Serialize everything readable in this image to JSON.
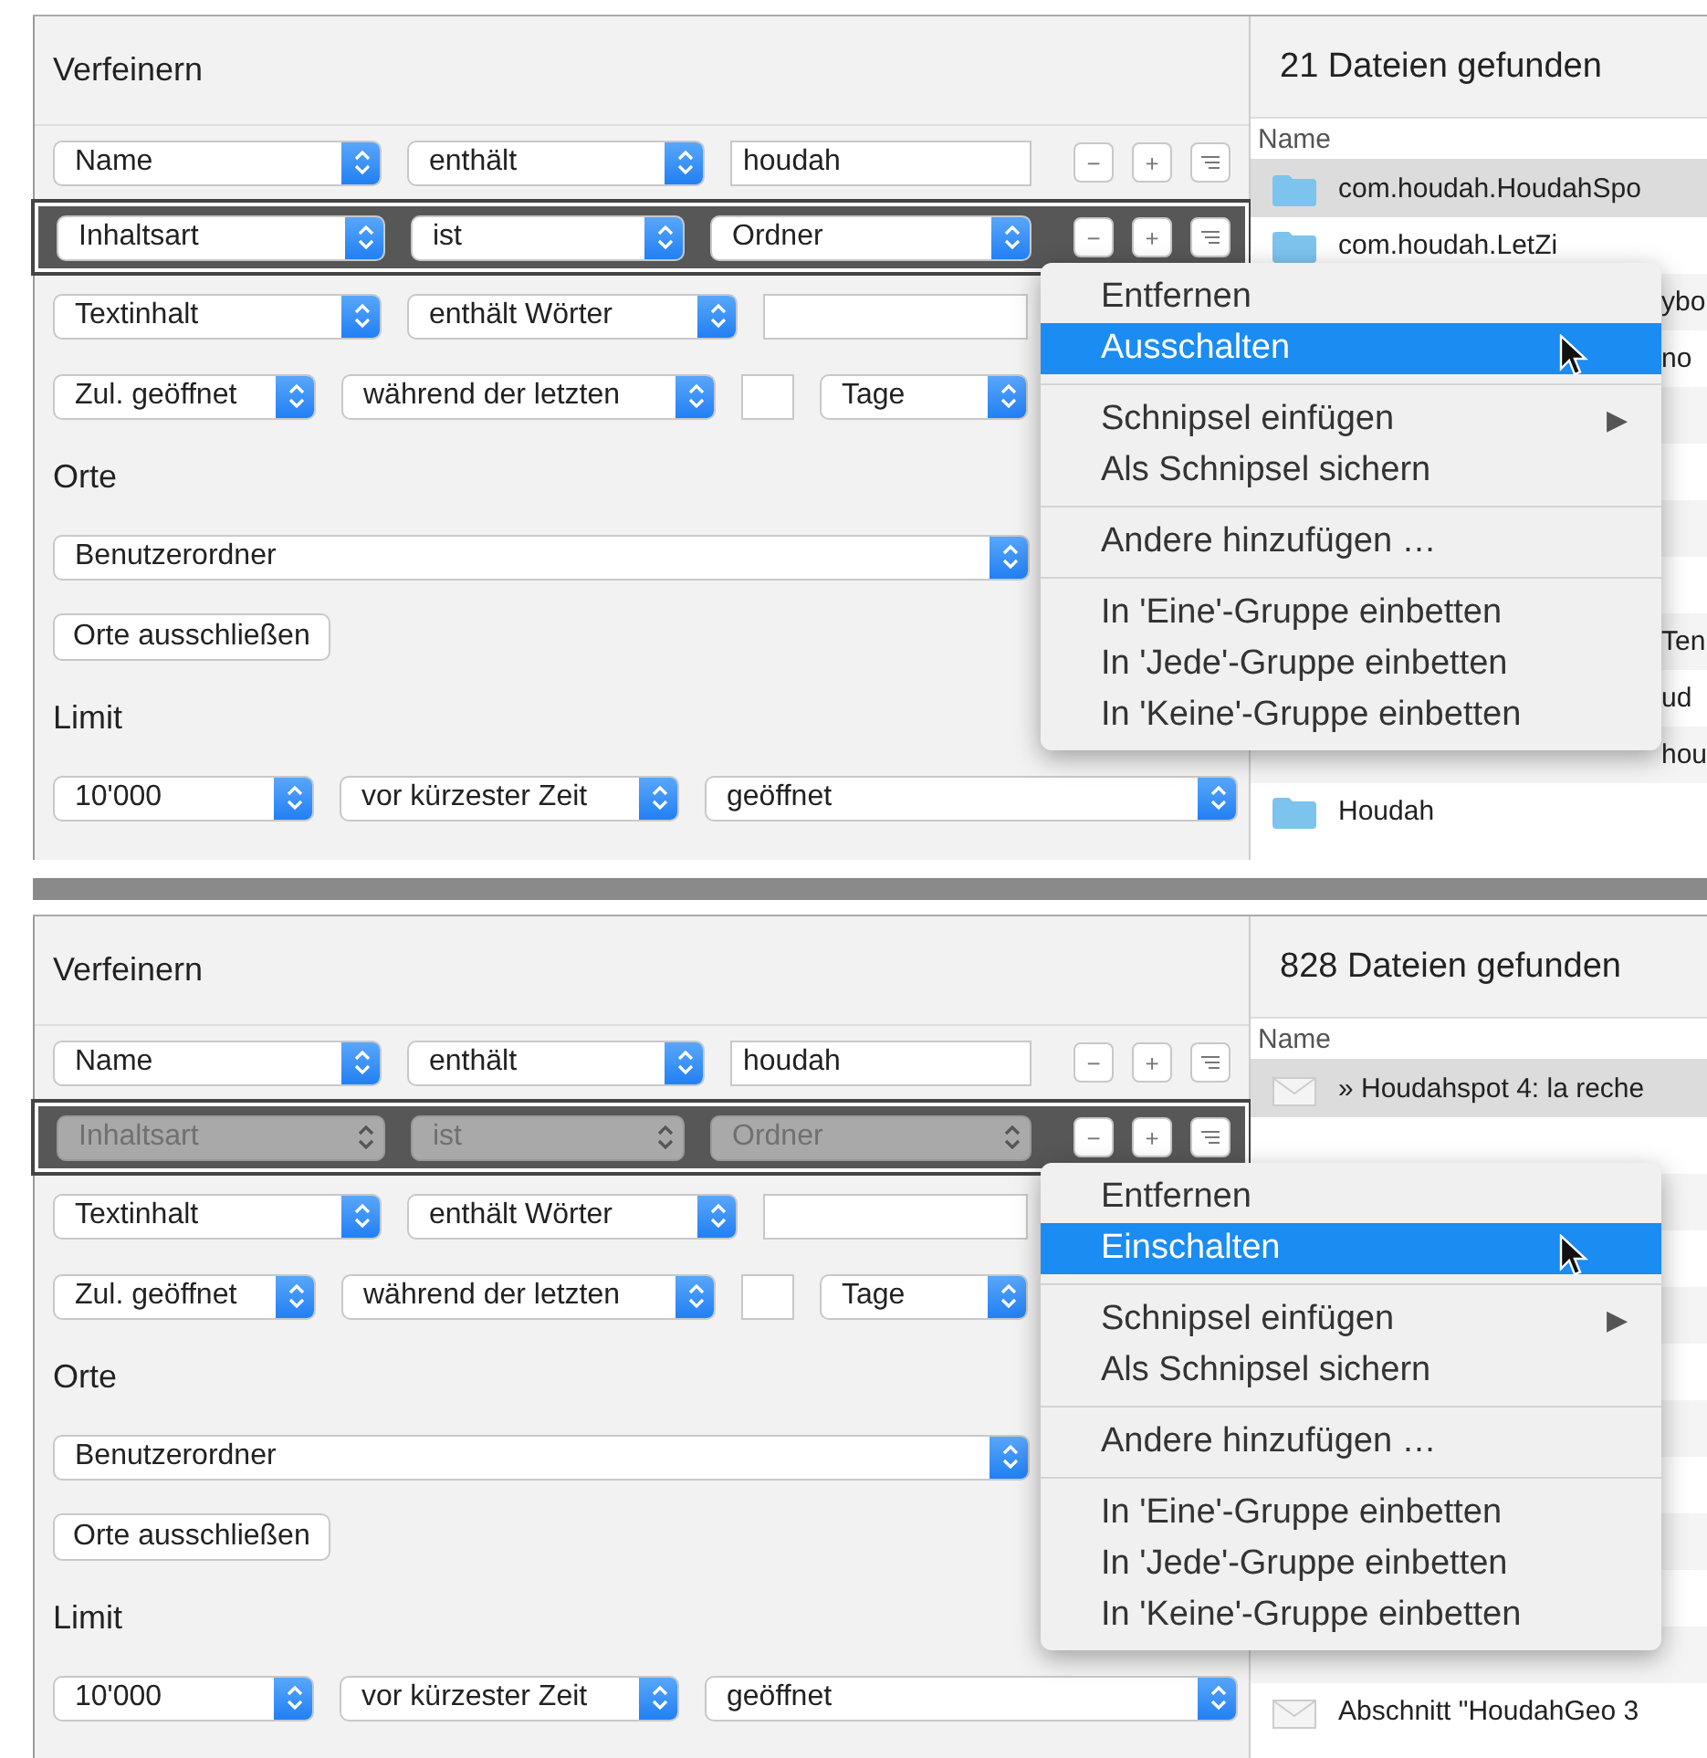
{
  "panels": [
    {
      "refine_title": "Verfeinern",
      "criteria": [
        {
          "kind": "text",
          "field": "Name",
          "operator": "enthält",
          "value": "houdah",
          "highlighted": false,
          "disabled": false,
          "buttons": [
            "−",
            "+"
          ]
        },
        {
          "kind": "popup",
          "field": "Inhaltsart",
          "operator": "ist",
          "value": "Ordner",
          "highlighted": true,
          "disabled": false,
          "buttons": [
            "−",
            "+"
          ]
        },
        {
          "kind": "words",
          "field": "Textinhalt",
          "operator": "enthält Wörter",
          "highlighted": false,
          "disabled": false
        },
        {
          "kind": "days",
          "field": "Zul. geöffnet",
          "operator": "während der letzten",
          "unit": "Tage",
          "highlighted": false,
          "disabled": false
        }
      ],
      "locations_title": "Orte",
      "location": "Benutzerordner",
      "exclude_button": "Orte ausschließen",
      "limit_title": "Limit",
      "limit": {
        "count": "10'000",
        "order": "vor kürzester Zeit",
        "by": "geöffnet"
      },
      "results": {
        "title": "21 Dateien gefunden",
        "column": "Name",
        "rows": [
          {
            "kind": "folder",
            "name": "com.houdah.HoudahSpo",
            "selected": true
          },
          {
            "kind": "folder",
            "name": "com.houdah.LetZi",
            "selected": false
          },
          {
            "kind": "partial",
            "name": "ybo",
            "selected": false
          },
          {
            "kind": "partial",
            "name": "no",
            "selected": false
          },
          {
            "kind": "covered",
            "selected": false
          },
          {
            "kind": "covered",
            "selected": false
          },
          {
            "kind": "covered",
            "selected": false
          },
          {
            "kind": "covered",
            "selected": false
          },
          {
            "kind": "partial",
            "name": "Ten",
            "selected": false
          },
          {
            "kind": "partial",
            "name": "ud",
            "selected": false
          },
          {
            "kind": "partial",
            "name": "hou",
            "selected": false
          },
          {
            "kind": "folder",
            "name": "Houdah",
            "selected": false
          }
        ]
      },
      "menu": {
        "items": [
          {
            "kind": "item",
            "label": "Entfernen",
            "highlighted": false
          },
          {
            "kind": "item",
            "label": "Ausschalten",
            "highlighted": true
          },
          {
            "kind": "separator"
          },
          {
            "kind": "submenu",
            "label": "Schnipsel einfügen",
            "arrow": "▶",
            "highlighted": false
          },
          {
            "kind": "item",
            "label": "Als Schnipsel sichern",
            "highlighted": false
          },
          {
            "kind": "separator"
          },
          {
            "kind": "item",
            "label": "Andere hinzufügen …",
            "highlighted": false
          },
          {
            "kind": "separator"
          },
          {
            "kind": "item",
            "label": "In 'Eine'-Gruppe einbetten",
            "highlighted": false
          },
          {
            "kind": "item",
            "label": "In 'Jede'-Gruppe einbetten",
            "highlighted": false
          },
          {
            "kind": "item",
            "label": "In 'Keine'-Gruppe einbetten",
            "highlighted": false
          }
        ]
      }
    },
    {
      "refine_title": "Verfeinern",
      "criteria": [
        {
          "kind": "text",
          "field": "Name",
          "operator": "enthält",
          "value": "houdah",
          "highlighted": false,
          "disabled": false,
          "buttons": [
            "−",
            "+"
          ]
        },
        {
          "kind": "popup",
          "field": "Inhaltsart",
          "operator": "ist",
          "value": "Ordner",
          "highlighted": true,
          "disabled": true,
          "buttons": [
            "−",
            "+"
          ]
        },
        {
          "kind": "words",
          "field": "Textinhalt",
          "operator": "enthält Wörter",
          "highlighted": false,
          "disabled": false
        },
        {
          "kind": "days",
          "field": "Zul. geöffnet",
          "operator": "während der letzten",
          "unit": "Tage",
          "highlighted": false,
          "disabled": false
        }
      ],
      "locations_title": "Orte",
      "location": "Benutzerordner",
      "exclude_button": "Orte ausschließen",
      "limit_title": "Limit",
      "limit": {
        "count": "10'000",
        "order": "vor kürzester Zeit",
        "by": "geöffnet"
      },
      "results": {
        "title": "828 Dateien gefunden",
        "column": "Name",
        "rows": [
          {
            "kind": "mail",
            "name": "» Houdahspot 4: la reche",
            "selected": true
          },
          {
            "kind": "covered",
            "selected": false
          },
          {
            "kind": "covered",
            "selected": false
          },
          {
            "kind": "covered",
            "selected": false
          },
          {
            "kind": "covered",
            "selected": false
          },
          {
            "kind": "covered",
            "selected": false
          },
          {
            "kind": "covered",
            "selected": false
          },
          {
            "kind": "covered",
            "selected": false
          },
          {
            "kind": "covered",
            "selected": false
          },
          {
            "kind": "covered",
            "selected": false
          },
          {
            "kind": "covered",
            "selected": false
          },
          {
            "kind": "mail",
            "name": "Abschnitt \"HoudahGeo 3",
            "selected": false
          }
        ]
      },
      "menu": {
        "items": [
          {
            "kind": "item",
            "label": "Entfernen",
            "highlighted": false
          },
          {
            "kind": "item",
            "label": "Einschalten",
            "highlighted": true
          },
          {
            "kind": "separator"
          },
          {
            "kind": "submenu",
            "label": "Schnipsel einfügen",
            "arrow": "▶",
            "highlighted": false
          },
          {
            "kind": "item",
            "label": "Als Schnipsel sichern",
            "highlighted": false
          },
          {
            "kind": "separator"
          },
          {
            "kind": "item",
            "label": "Andere hinzufügen …",
            "highlighted": false
          },
          {
            "kind": "separator"
          },
          {
            "kind": "item",
            "label": "In 'Eine'-Gruppe einbetten",
            "highlighted": false
          },
          {
            "kind": "item",
            "label": "In 'Jede'-Gruppe einbetten",
            "highlighted": false
          },
          {
            "kind": "item",
            "label": "In 'Keine'-Gruppe einbetten",
            "highlighted": false
          }
        ]
      }
    }
  ]
}
